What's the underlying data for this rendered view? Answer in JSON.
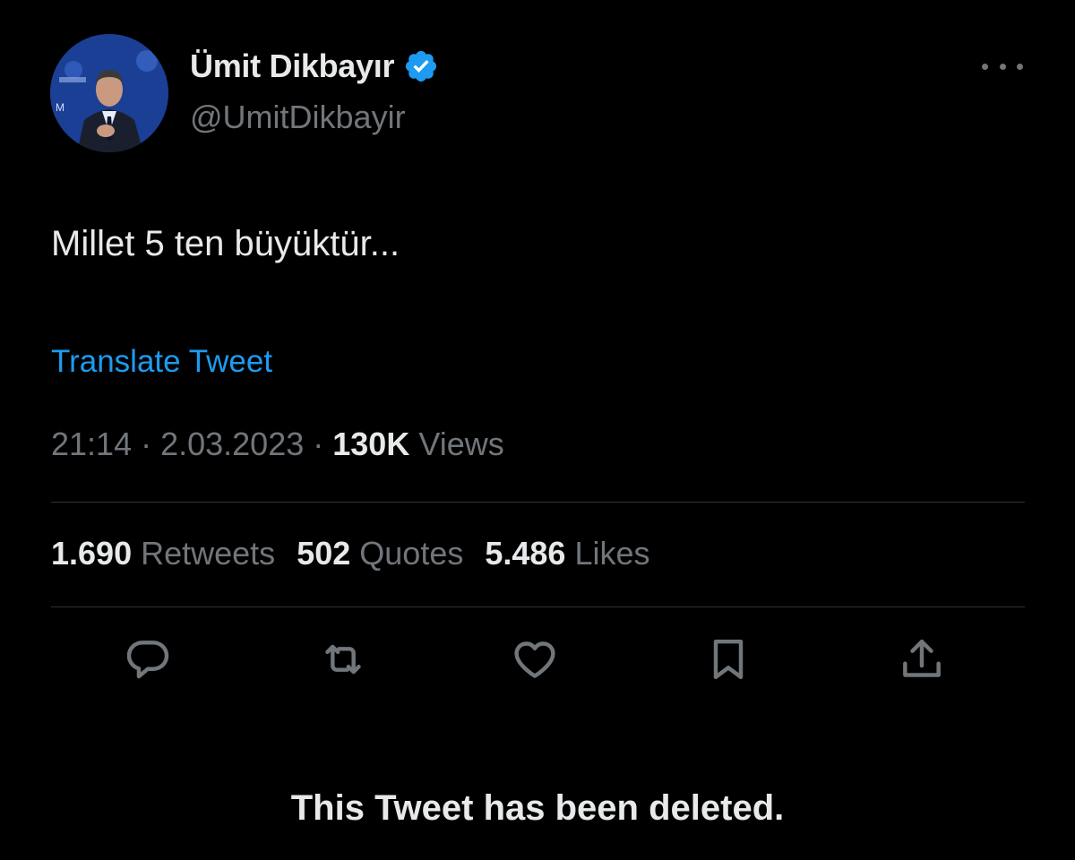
{
  "user": {
    "display_name": "Ümit Dikbayır",
    "handle": "@UmitDikbayir",
    "verified": true,
    "avatar_icon": "profile-photo"
  },
  "tweet": {
    "text": "Millet 5 ten büyüktür...",
    "translate_label": "Translate Tweet",
    "time": "21:14",
    "separator": " · ",
    "date": "2.03.2023",
    "views_count": "130K",
    "views_label": "Views"
  },
  "stats": {
    "retweets_count": "1.690",
    "retweets_label": "Retweets",
    "quotes_count": "502",
    "quotes_label": "Quotes",
    "likes_count": "5.486",
    "likes_label": "Likes"
  },
  "actions": {
    "reply_icon": "reply-icon",
    "retweet_icon": "retweet-icon",
    "like_icon": "heart-icon",
    "bookmark_icon": "bookmark-icon",
    "share_icon": "share-icon"
  },
  "notice": {
    "deleted_text": "This Tweet has been deleted."
  },
  "colors": {
    "background": "#000000",
    "primary_text": "#e7e9ea",
    "secondary_text": "#71767b",
    "accent": "#1d9bf0",
    "divider": "#2f3336"
  }
}
